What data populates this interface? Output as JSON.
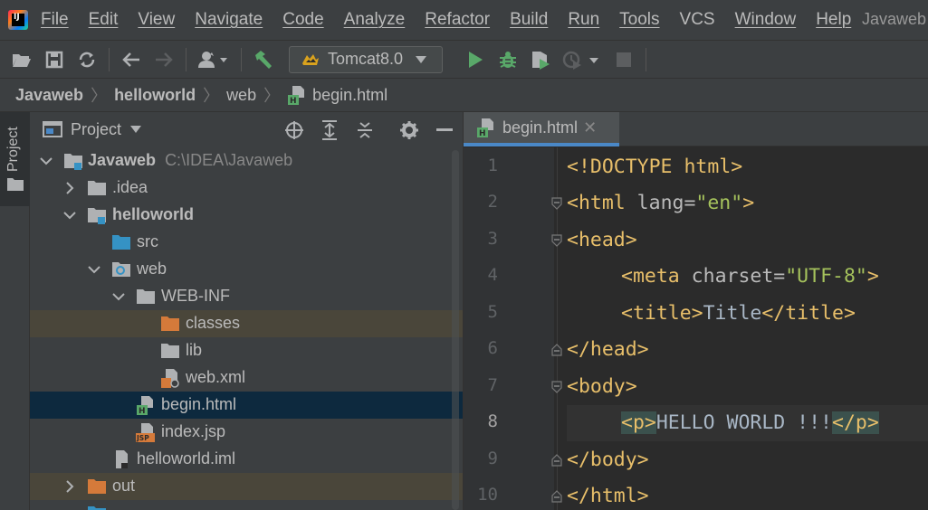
{
  "menu": {
    "items": [
      "File",
      "Edit",
      "View",
      "Navigate",
      "Code",
      "Analyze",
      "Refactor",
      "Build",
      "Run",
      "Tools",
      "VCS",
      "Window",
      "Help"
    ],
    "window_title": "Javaweb"
  },
  "toolbar": {
    "icons": [
      "open-folder-icon",
      "save-icon",
      "sync-icon",
      "back-arrow-icon",
      "forward-arrow-icon",
      "user-icon",
      "build-hammer-icon",
      "run-icon",
      "debug-icon",
      "coverage-icon",
      "profile-icon",
      "stop-icon"
    ],
    "run_config_label": "Tomcat8.0"
  },
  "breadcrumb": [
    "Javaweb",
    "helloworld",
    "web",
    "begin.html"
  ],
  "tool_stripe": {
    "project_tab_label": "Project"
  },
  "project_panel": {
    "title": "Project",
    "tree": [
      {
        "label": "Javaweb",
        "path": "C:\\IDEA\\Javaweb",
        "icon": "module-folder",
        "expanded": true,
        "bold": true
      },
      {
        "label": ".idea",
        "icon": "folder",
        "expanded": false
      },
      {
        "label": "helloworld",
        "icon": "module-folder",
        "expanded": true,
        "bold": true
      },
      {
        "label": "src",
        "icon": "source-folder"
      },
      {
        "label": "web",
        "icon": "web-folder",
        "expanded": true
      },
      {
        "label": "WEB-INF",
        "icon": "folder",
        "expanded": true
      },
      {
        "label": "classes",
        "icon": "excluded-folder",
        "excluded": true
      },
      {
        "label": "lib",
        "icon": "folder"
      },
      {
        "label": "web.xml",
        "icon": "xml-file"
      },
      {
        "label": "begin.html",
        "icon": "html-file",
        "selected": true
      },
      {
        "label": "index.jsp",
        "icon": "jsp-file"
      },
      {
        "label": "helloworld.iml",
        "icon": "iml-file"
      },
      {
        "label": "out",
        "icon": "excluded-folder",
        "expanded": false,
        "excluded": true
      }
    ]
  },
  "editor": {
    "tab_label": "begin.html",
    "current_line": 8,
    "line_numbers": [
      "1",
      "2",
      "3",
      "4",
      "5",
      "6",
      "7",
      "8",
      "9",
      "10"
    ],
    "code": {
      "l1": "<!DOCTYPE html>",
      "l2_open": "<html",
      "l2_attr": " lang=",
      "l2_val": "\"en\"",
      "l2_close": ">",
      "l3": "<head>",
      "l4_open": "<meta",
      "l4_attr": " charset=",
      "l4_val": "\"UTF-8\"",
      "l4_close": ">",
      "l5_open": "<title>",
      "l5_text": "Title",
      "l5_close": "</title>",
      "l6": "</head>",
      "l7": "<body>",
      "l8_open": "<p>",
      "l8_text": "HELLO WORLD !!!",
      "l8_close": "</p>",
      "l9": "</body>",
      "l10": "</html>"
    }
  },
  "colors": {
    "background": "#2b2b2b",
    "panel": "#3c3f41",
    "selection": "#0d293e",
    "excluded": "#4a463a",
    "tag": "#e8bf6a",
    "string": "#a5c25c",
    "text": "#a9b7c6",
    "run_green": "#59a869",
    "folder_blue": "#3592c4",
    "folder_orange": "#d57a3a",
    "accent": "#4a88c7"
  }
}
